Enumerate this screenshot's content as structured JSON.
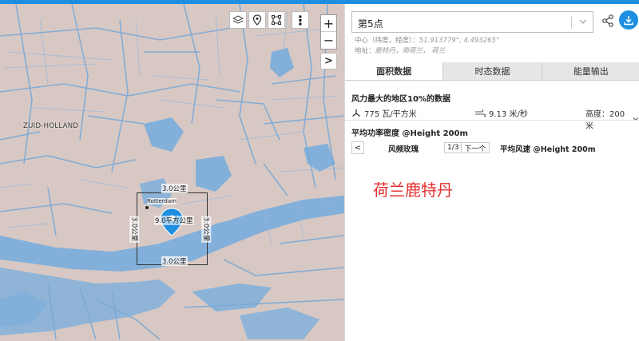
{
  "map": {
    "region_label": "ZUID-HOLLAND",
    "city_label": "Rotterdam",
    "dim_top": "3.0公里",
    "dim_bottom": "3.0公里",
    "dim_left": "3.0公里",
    "dim_right": "3.0公里",
    "area_label": "9.0平方公里",
    "zoom_in": "+",
    "zoom_out": "−",
    "expand_glyph": ">",
    "more_glyph": "⋮",
    "colors": {
      "land": "#d9c9c4",
      "water": "#7eaed9",
      "marker": "#1e8fe0"
    }
  },
  "panel": {
    "point_name": "第5点",
    "center_label": "中心（纬度，经度）：",
    "center_value": "51.913779°, 4.493265°",
    "address_label": "地址：",
    "address_value": "鹿特丹，南荷兰， 荷兰",
    "tabs": [
      {
        "label": "面积数据",
        "active": true
      },
      {
        "label": "时态数据",
        "active": false
      },
      {
        "label": "能量输出",
        "active": false
      }
    ],
    "windiest_title": "风力最大的地区10%的数据",
    "power_density": "775 瓦/平方米",
    "wind_speed": "9.13 米/秒",
    "height_label": "高度：200米",
    "pd_title": "平均功率密度 @Height 200m",
    "prev_glyph": "<",
    "rose_label": "风频玫瑰",
    "pager_current": "1/3",
    "pager_next": "下一个",
    "avg_speed_label": "平均风速 @Height 200m",
    "location_title": "荷兰鹿特丹",
    "accent": "#1e8fe0",
    "title_color": "#e43030"
  }
}
